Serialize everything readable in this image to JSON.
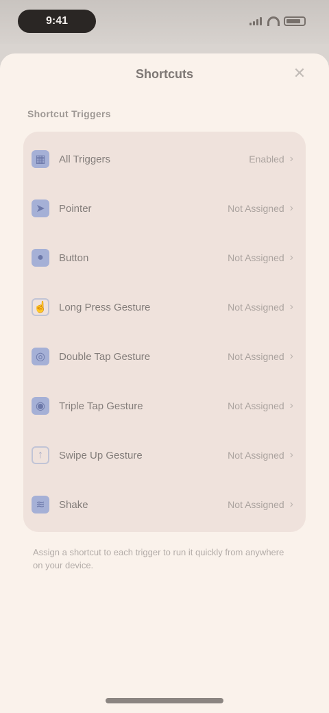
{
  "status_bar": {
    "time": "9:41"
  },
  "sheet": {
    "title": "Shortcuts",
    "close_icon": "close-icon"
  },
  "section": {
    "title": "Shortcut Triggers"
  },
  "rows": [
    {
      "label": "All Triggers",
      "value": "Enabled",
      "icon": "grid-icon",
      "style": "filled"
    },
    {
      "label": "Pointer",
      "value": "Not Assigned",
      "icon": "pointer-icon",
      "style": "filled"
    },
    {
      "label": "Button",
      "value": "Not Assigned",
      "icon": "button-icon",
      "style": "filled"
    },
    {
      "label": "Long Press Gesture",
      "value": "Not Assigned",
      "icon": "hand-icon",
      "style": "outline"
    },
    {
      "label": "Double Tap Gesture",
      "value": "Not Assigned",
      "icon": "double-tap-icon",
      "style": "filled"
    },
    {
      "label": "Triple Tap Gesture",
      "value": "Not Assigned",
      "icon": "triple-tap-icon",
      "style": "filled"
    },
    {
      "label": "Swipe Up Gesture",
      "value": "Not Assigned",
      "icon": "swipe-icon",
      "style": "outline"
    },
    {
      "label": "Shake",
      "value": "Not Assigned",
      "icon": "shake-icon",
      "style": "filled"
    }
  ],
  "footnote": "Assign a shortcut to each trigger to run it quickly from anywhere on your device."
}
